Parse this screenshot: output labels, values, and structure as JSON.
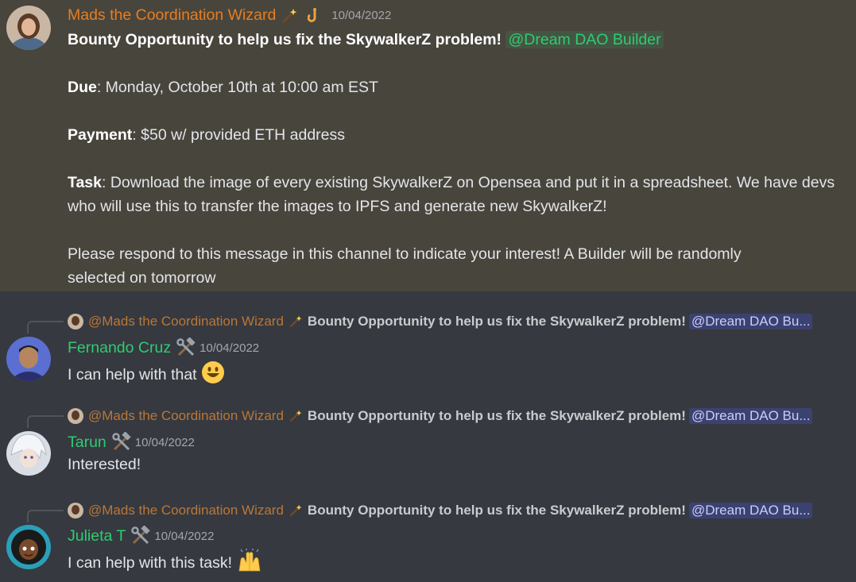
{
  "main_message": {
    "author": "Mads the Coordination Wizard",
    "author_color": "#e67e22",
    "badges": [
      "wand-icon",
      "hook-icon"
    ],
    "timestamp": "10/04/2022",
    "title": "Bounty Opportunity to help us fix the SkywalkerZ problem!",
    "mention": "@Dream DAO Builder",
    "due_label": "Due",
    "due_value": ": Monday, October 10th at 10:00 am EST",
    "payment_label": "Payment",
    "payment_value": ": $50 w/ provided ETH address",
    "task_label": "Task",
    "task_value": ": Download the image of every existing SkywalkerZ on Opensea and put it in a spreadsheet. We have devs who will use this to transfer the images to IPFS and generate new SkywalkerZ!",
    "closing": "Please respond to this message in this channel to indicate your interest!  A Builder will be randomly selected on tomorrow"
  },
  "reply_reference": {
    "author": "@Mads the Coordination Wizard",
    "preview": "Bounty Opportunity to help us fix the SkywalkerZ problem!",
    "mention": "@Dream DAO Bu..."
  },
  "replies": [
    {
      "author": "Fernando Cruz",
      "badge": "hammer-wrench-icon",
      "timestamp": "10/04/2022",
      "text": "I can help with that",
      "emoji": "smiley-face-icon"
    },
    {
      "author": "Tarun",
      "badge": "hammer-wrench-icon",
      "timestamp": "10/04/2022",
      "text": "Interested!",
      "emoji": ""
    },
    {
      "author": "Julieta T",
      "badge": "hammer-wrench-icon",
      "timestamp": "10/04/2022",
      "text": "I can help with this task!",
      "emoji": "raised-hands-icon"
    }
  ],
  "colors": {
    "background": "#36393f",
    "highlight": "#48453d",
    "member_green": "#2ecc71",
    "mention_blue_bg": "#3c4270"
  }
}
